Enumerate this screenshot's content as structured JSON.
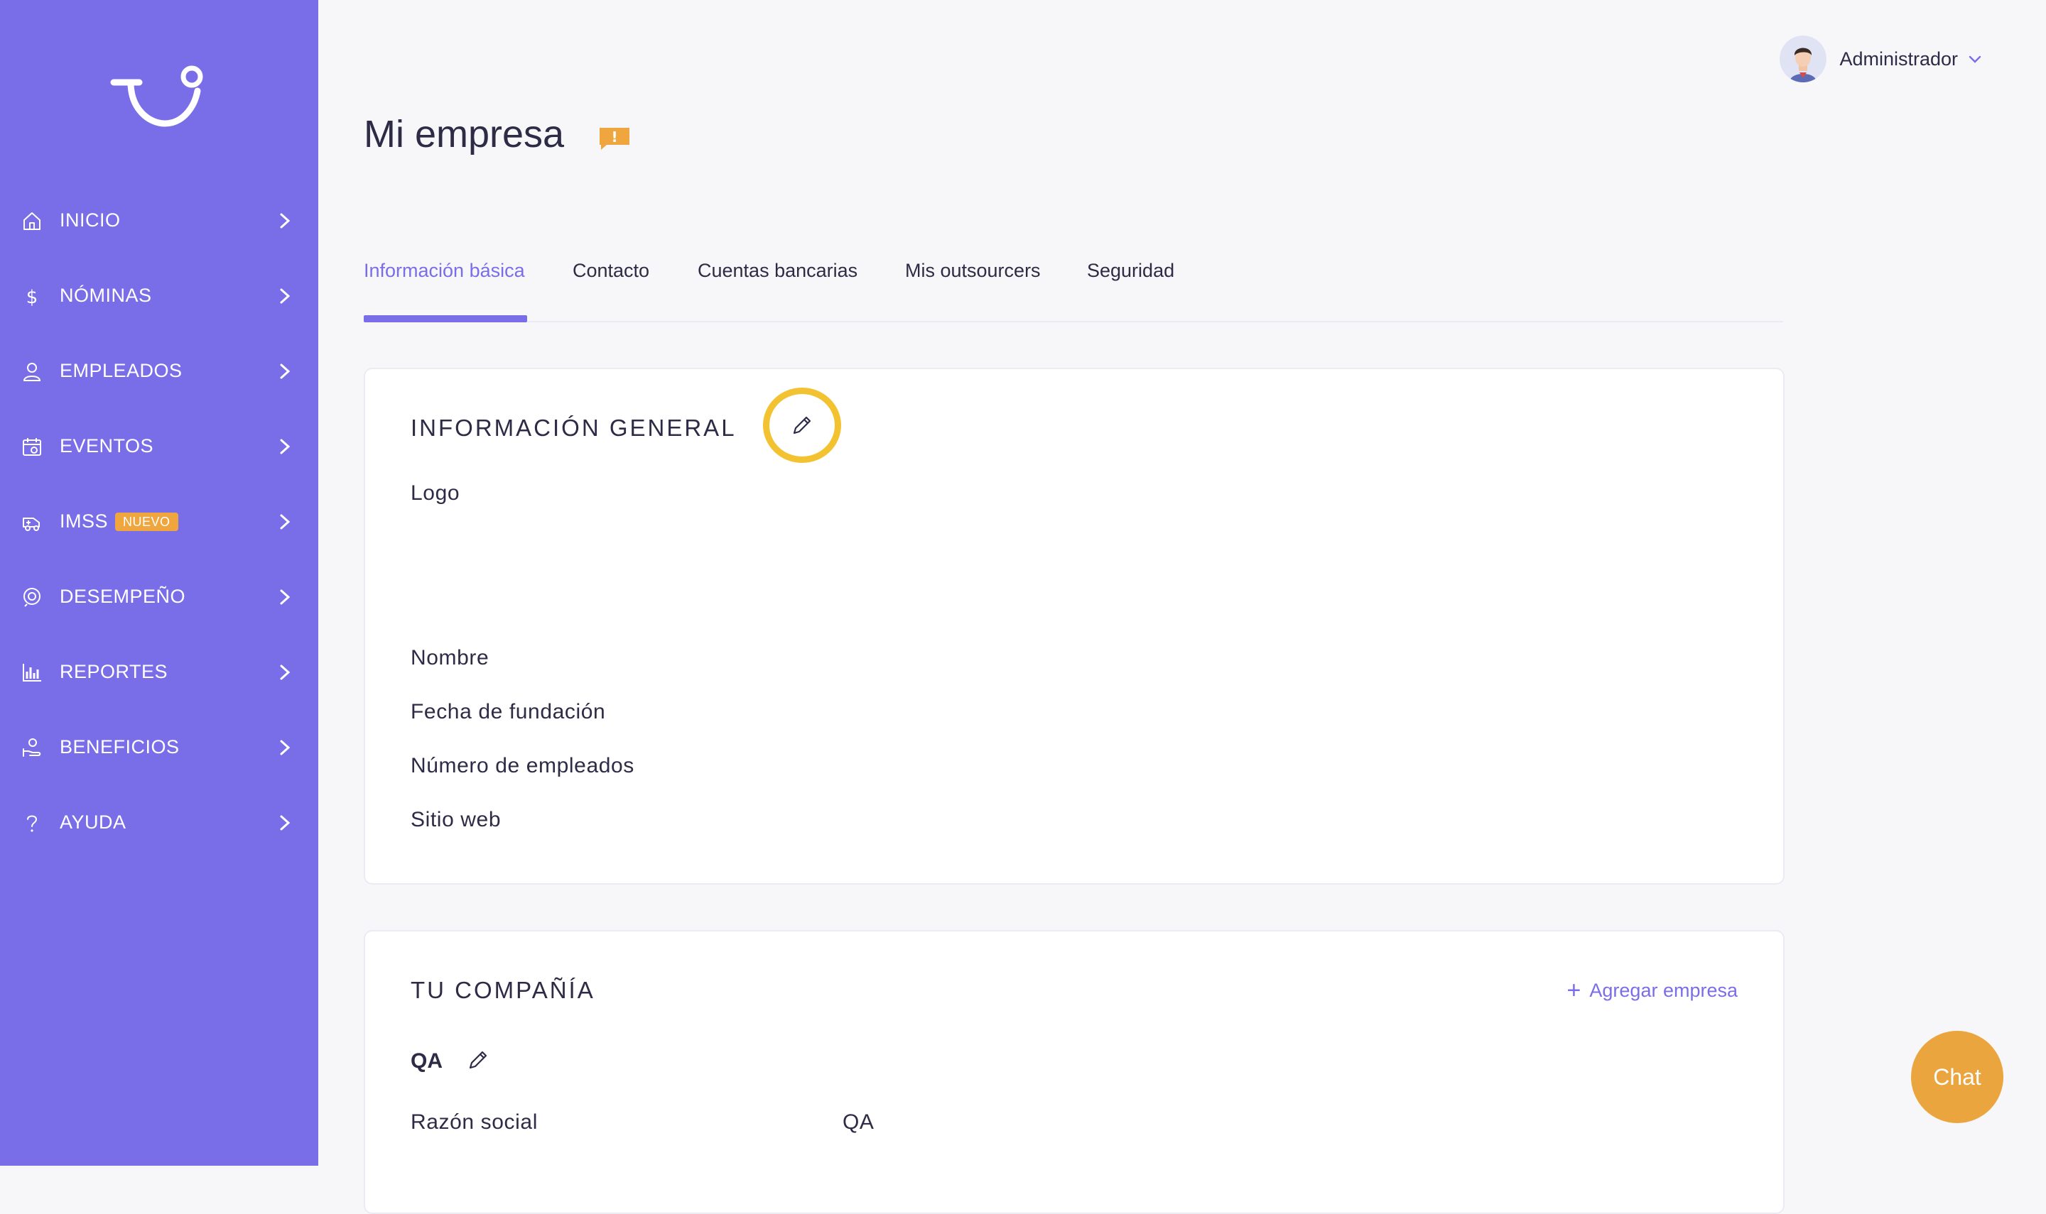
{
  "sidebar": {
    "items": [
      {
        "label": "INICIO",
        "icon": "home-icon"
      },
      {
        "label": "NÓMINAS",
        "icon": "dollar-icon"
      },
      {
        "label": "EMPLEADOS",
        "icon": "user-icon"
      },
      {
        "label": "EVENTOS",
        "icon": "calendar-icon"
      },
      {
        "label": "IMSS",
        "icon": "ambulance-icon",
        "badge": "NUEVO"
      },
      {
        "label": "DESEMPEÑO",
        "icon": "performance-icon"
      },
      {
        "label": "REPORTES",
        "icon": "chart-icon"
      },
      {
        "label": "BENEFICIOS",
        "icon": "benefits-icon"
      },
      {
        "label": "AYUDA",
        "icon": "help-icon"
      }
    ]
  },
  "header": {
    "user_name": "Administrador",
    "page_title": "Mi empresa",
    "alert_symbol": "!"
  },
  "tabs": [
    {
      "label": "Información básica",
      "active": true
    },
    {
      "label": "Contacto"
    },
    {
      "label": "Cuentas bancarias"
    },
    {
      "label": "Mis outsourcers"
    },
    {
      "label": "Seguridad"
    }
  ],
  "general_info": {
    "title": "INFORMACIÓN GENERAL",
    "fields": [
      "Logo",
      "Nombre",
      "Fecha de fundación",
      "Número de empleados",
      "Sitio web"
    ]
  },
  "company": {
    "title": "TU COMPAÑÍA",
    "add_label": "Agregar empresa",
    "name": "QA",
    "fields": [
      {
        "label": "Razón social",
        "value": "QA"
      }
    ]
  },
  "chat_label": "Chat",
  "colors": {
    "sidebar": "#7a6ee8",
    "accent": "#7a6ee8",
    "badge": "#f0a63e",
    "highlight": "#f2c230",
    "chat": "#eba53f"
  }
}
